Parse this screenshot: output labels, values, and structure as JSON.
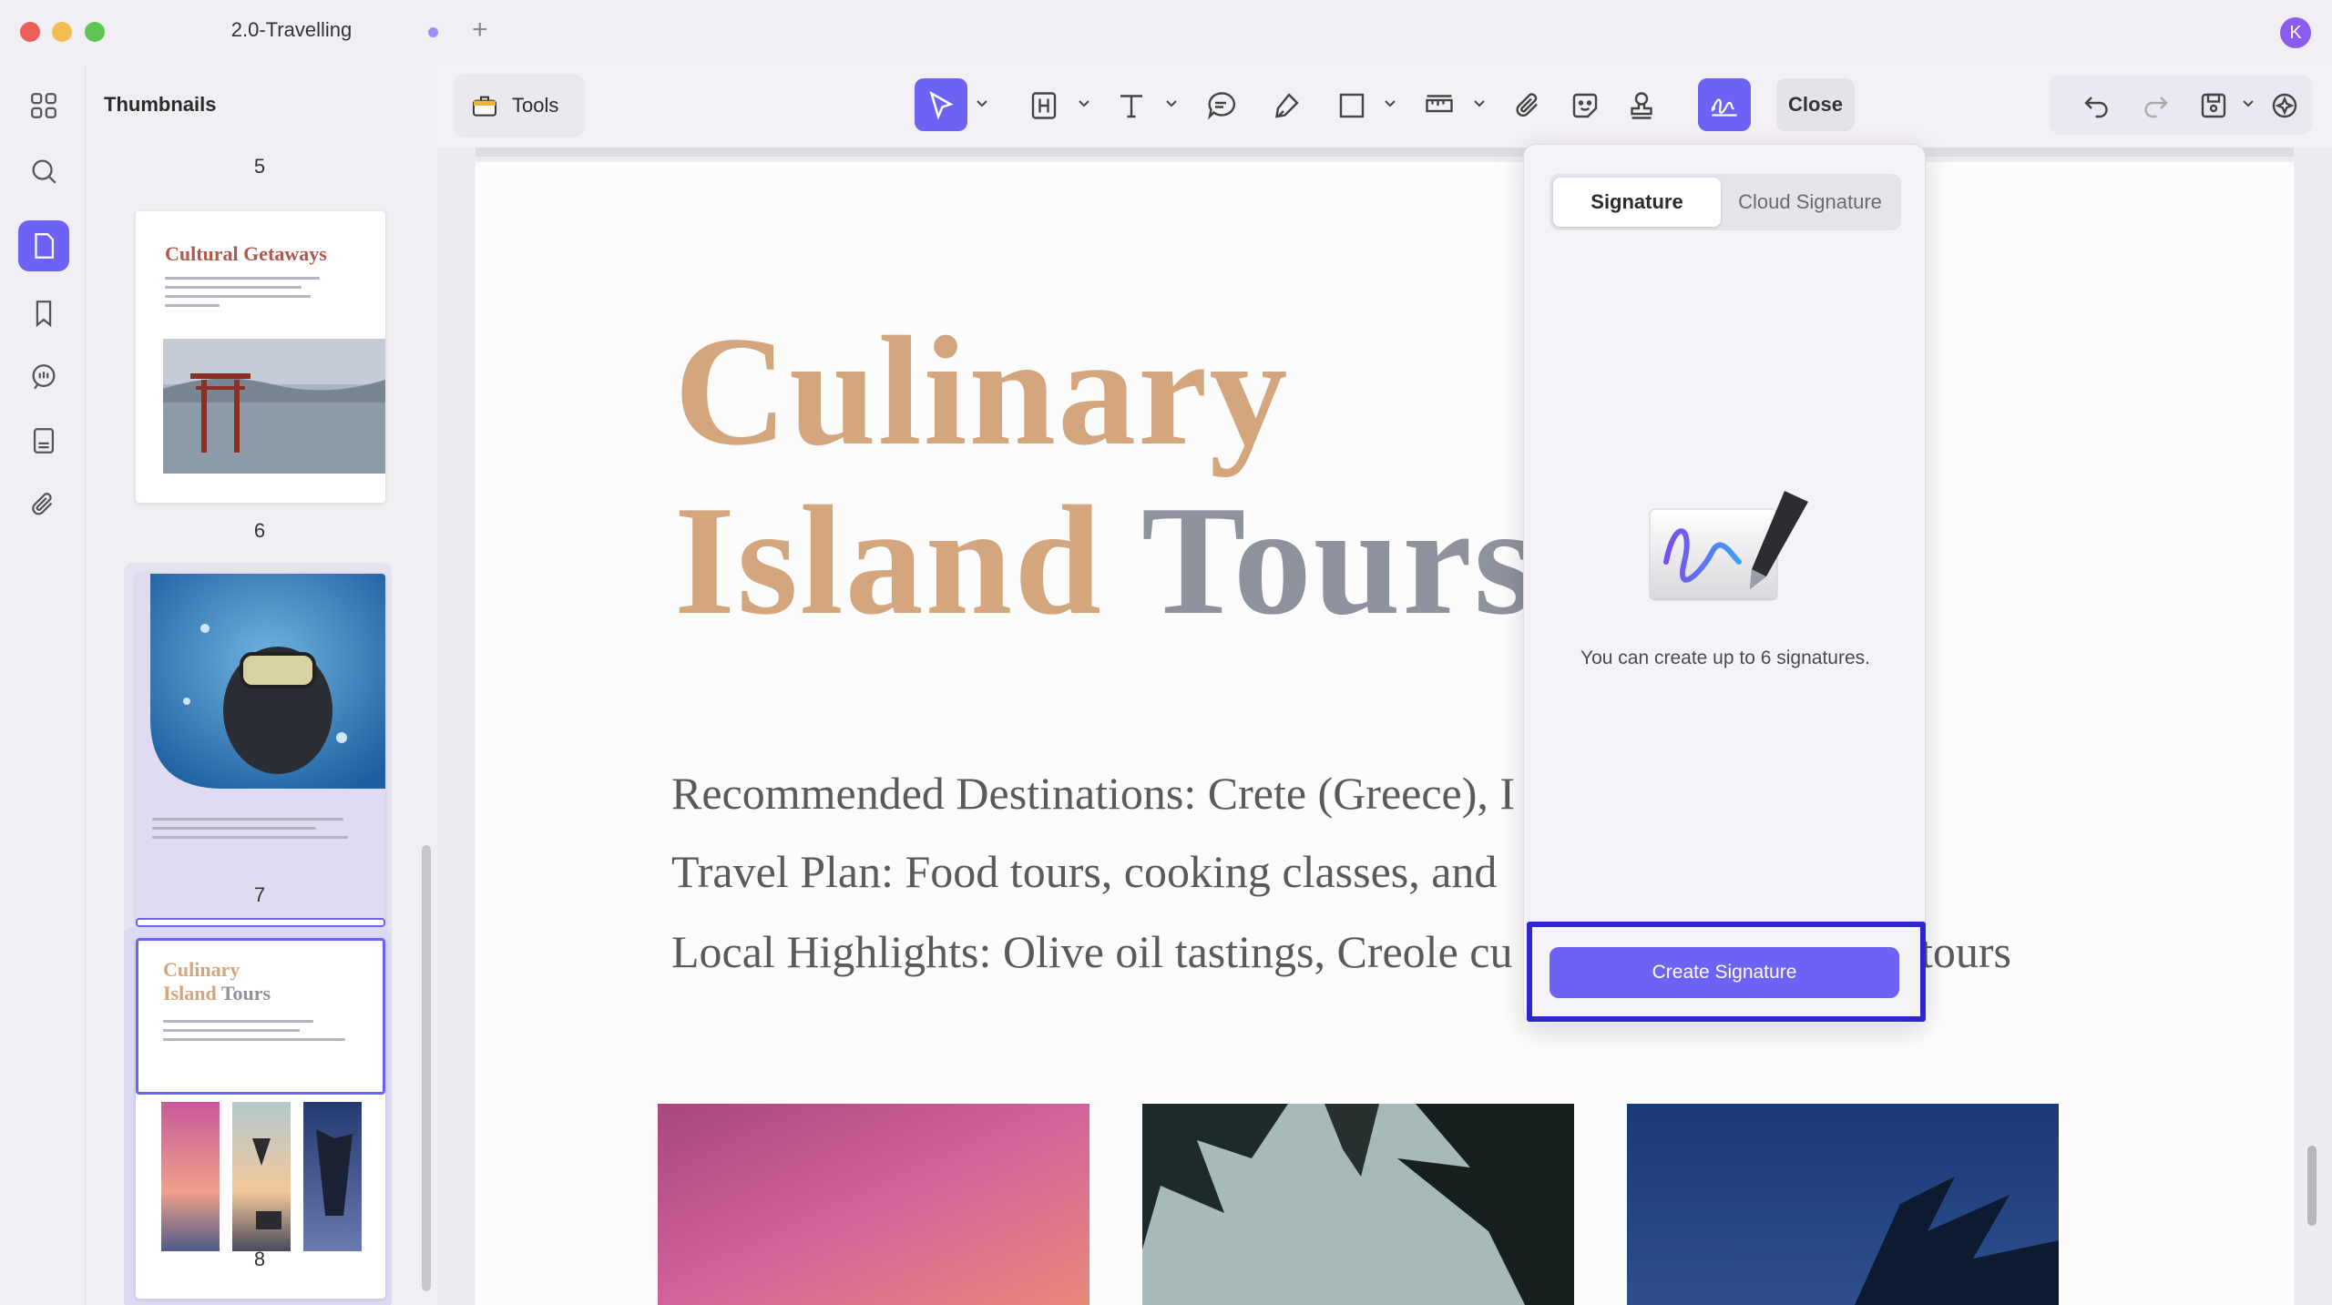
{
  "window": {
    "tab_title": "2.0-Travelling",
    "avatar_initial": "K"
  },
  "sidebar": {
    "title": "Thumbnails",
    "items": [
      "apps-icon",
      "search-icon",
      "pages-icon",
      "bookmark-icon",
      "comments-icon",
      "forms-icon",
      "attachment-icon"
    ]
  },
  "thumbnails": {
    "pages": [
      {
        "number": "5"
      },
      {
        "number": "6",
        "title": "Cultural Getaways"
      },
      {
        "number": "7"
      },
      {
        "number": "8",
        "title_line1": "Culinary",
        "title_line2_a": "Island",
        "title_line2_b": "Tours"
      }
    ]
  },
  "toolbar": {
    "tools_label": "Tools",
    "close_label": "Close"
  },
  "document": {
    "title_word1": "Culinary",
    "title_word2": "Island",
    "title_word3": "Tours",
    "line1": "Recommended Destinations: Crete (Greece), I",
    "line2": "Travel Plan: Food tours, cooking classes, and",
    "line3_a": "Local Highlights: Olive oil tastings, Creole cu",
    "line3_b": "tours"
  },
  "signature_panel": {
    "tab_signature": "Signature",
    "tab_cloud": "Cloud Signature",
    "hint": "You can create up to 6 signatures.",
    "create_button": "Create Signature"
  },
  "colors": {
    "accent": "#6c63f5",
    "title_tan": "#d4a67e",
    "title_gray": "#8d929c",
    "highlight_frame": "#2f27c9"
  }
}
